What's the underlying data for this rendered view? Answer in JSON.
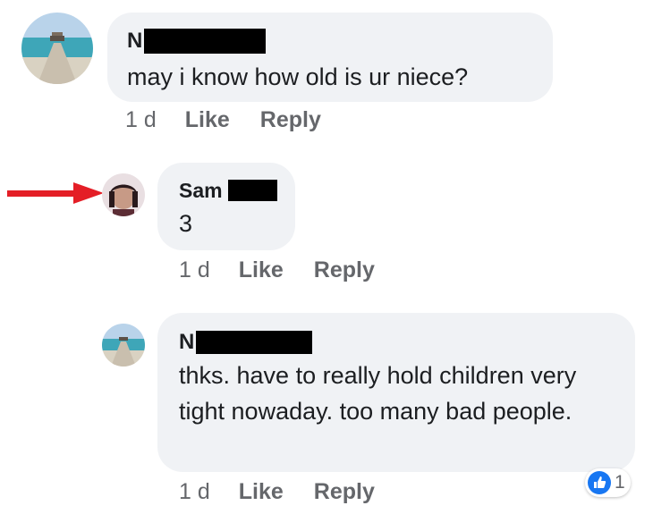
{
  "comments": [
    {
      "author": "N",
      "text": "may i know how old is ur niece?",
      "time": "1 d",
      "like_label": "Like",
      "reply_label": "Reply"
    },
    {
      "author": "Sam",
      "text": "3",
      "time": "1 d",
      "like_label": "Like",
      "reply_label": "Reply"
    },
    {
      "author": "N",
      "text": "thks. have to really hold children very tight nowaday. too many bad people.",
      "time": "1 d",
      "like_label": "Like",
      "reply_label": "Reply",
      "reaction_count": "1"
    }
  ],
  "colors": {
    "bubble": "#f0f2f5",
    "meta_text": "#65676b",
    "like_blue": "#1877f2",
    "arrow_red": "#e41e26"
  },
  "icons": [
    "arrow-icon",
    "like-reaction-icon"
  ]
}
